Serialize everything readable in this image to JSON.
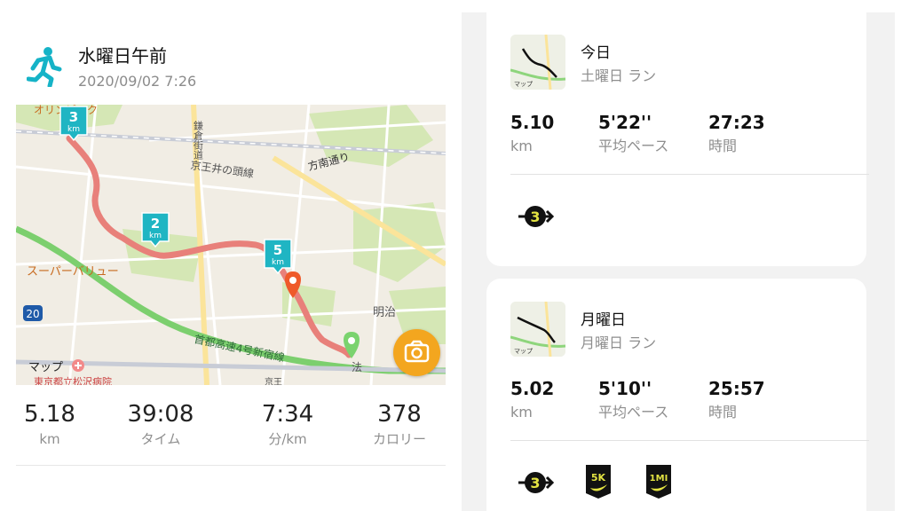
{
  "run": {
    "title": "水曜日午前",
    "datetime": "2020/09/02 7:26"
  },
  "map": {
    "labels": {
      "top_left_poi": "オリンピック",
      "kamakura_road": "鎌倉街道",
      "keio_line": "京王井の頭線",
      "hounan_dori": "方南通り",
      "supermarket": "スーパーバリュー",
      "route_number": "20",
      "expressway": "首都高速4号新宿線",
      "meiji": "明治",
      "hosei": "法",
      "apple_maps": "マップ",
      "hospital": "東京都立松沢病院",
      "bottom_right": "京王"
    },
    "km_markers": [
      {
        "num": "3",
        "unit": "km"
      },
      {
        "num": "2",
        "unit": "km"
      },
      {
        "num": "5",
        "unit": "km"
      }
    ]
  },
  "stats": [
    {
      "value": "5.18",
      "label": "km"
    },
    {
      "value": "39:08",
      "label": "タイム"
    },
    {
      "value": "7:34",
      "label": "分/km"
    },
    {
      "value": "378",
      "label": "カロリー"
    }
  ],
  "activities": [
    {
      "title": "今日",
      "subtitle": "土曜日 ラン",
      "thumb_label": "マップ",
      "stats": [
        {
          "value": "5.10",
          "label": "km"
        },
        {
          "value": "5'22''",
          "label": "平均ペース"
        },
        {
          "value": "27:23",
          "label": "時間"
        }
      ],
      "badges": [
        "3"
      ]
    },
    {
      "title": "月曜日",
      "subtitle": "月曜日 ラン",
      "thumb_label": "マップ",
      "stats": [
        {
          "value": "5.02",
          "label": "km"
        },
        {
          "value": "5'10''",
          "label": "平均ペース"
        },
        {
          "value": "25:57",
          "label": "時間"
        }
      ],
      "badges": [
        "3",
        "5K",
        "1MI"
      ]
    }
  ],
  "colors": {
    "route": "#e8807a",
    "marker_teal": "#1fb5c3",
    "camera": "#f3a61f",
    "highway_green": "#7ccf6e",
    "badge_yellow": "#e3e342"
  }
}
